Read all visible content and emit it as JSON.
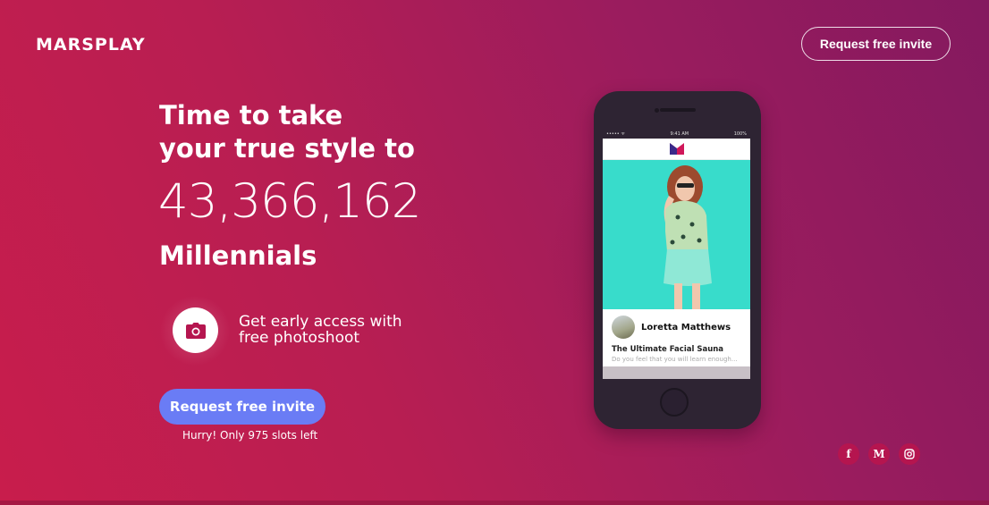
{
  "brand": {
    "logo_text": "MARSPLAY"
  },
  "header": {
    "cta_label": "Request free invite"
  },
  "hero": {
    "headline_line1": "Time to take",
    "headline_line2": "your true style to",
    "counter": "43,366,162",
    "audience": "Millennials"
  },
  "feature": {
    "icon": "camera-icon",
    "line1": "Get early access with",
    "line2": "free photoshoot"
  },
  "cta": {
    "label": "Request free invite",
    "note": "Hurry! Only 975 slots left"
  },
  "phone": {
    "status_left": "••••• ᯤ",
    "status_time": "9:41 AM",
    "status_right": "100%",
    "author": "Loretta Matthews",
    "post_title": "The Ultimate Facial Sauna",
    "post_excerpt": "Do you feel that you will learn enough..."
  },
  "socials": [
    {
      "icon": "facebook-icon",
      "glyph": "f"
    },
    {
      "icon": "medium-icon",
      "glyph": "M"
    },
    {
      "icon": "instagram-icon",
      "glyph": ""
    }
  ],
  "colors": {
    "accent_button": "#6a7cf5",
    "bg_start": "#c81d4c",
    "bg_end": "#84195f",
    "social_bg": "#b5154f"
  }
}
